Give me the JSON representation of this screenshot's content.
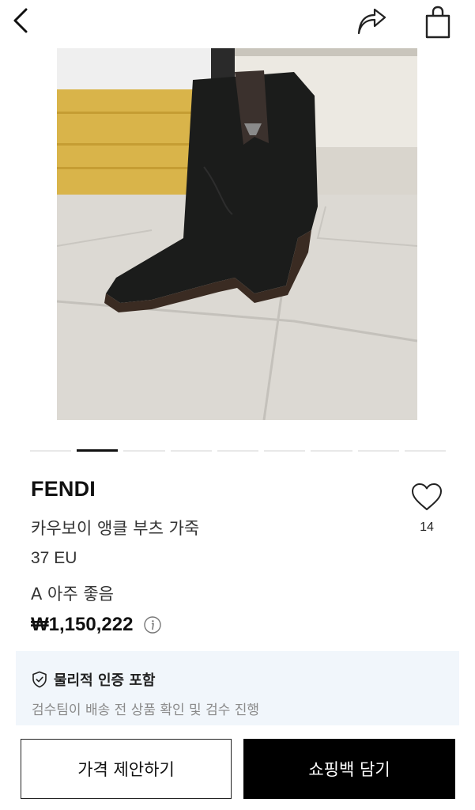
{
  "header": {
    "back_icon": "chevron-left-icon",
    "share_icon": "share-arrow-icon",
    "bag_icon": "shopping-bag-icon"
  },
  "gallery": {
    "page_count": 9,
    "active_index": 1
  },
  "product": {
    "brand": "FENDI",
    "name": "카우보이 앵클 부츠 가죽",
    "size": "37 EU",
    "condition": "A 아주 좋음",
    "price": "₩1,150,222",
    "like_count": "14"
  },
  "certification": {
    "title": "물리적 인증 포함",
    "description": "검수팀이 배송 전 상품 확인 및 검수 진행"
  },
  "actions": {
    "offer_label": "가격 제안하기",
    "cart_label": "쇼핑백 담기"
  }
}
